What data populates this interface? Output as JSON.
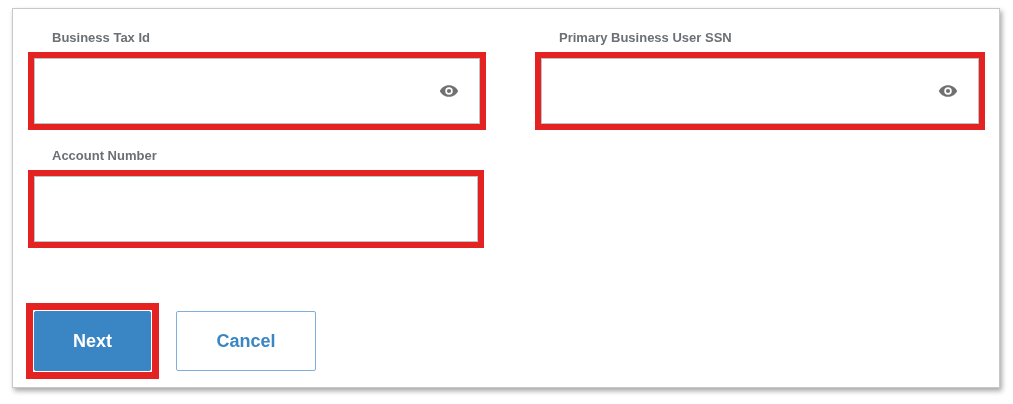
{
  "fields": [
    {
      "label": "Business Tax Id",
      "masked": true,
      "highlighted": true
    },
    {
      "label": "Primary Business User SSN",
      "masked": true,
      "highlighted": true
    },
    {
      "label": "Account Number",
      "masked": false,
      "highlighted": true
    }
  ],
  "buttons": [
    {
      "label": "Next",
      "kind": "primary",
      "highlighted": true
    },
    {
      "label": "Cancel",
      "kind": "secondary",
      "highlighted": false
    }
  ]
}
